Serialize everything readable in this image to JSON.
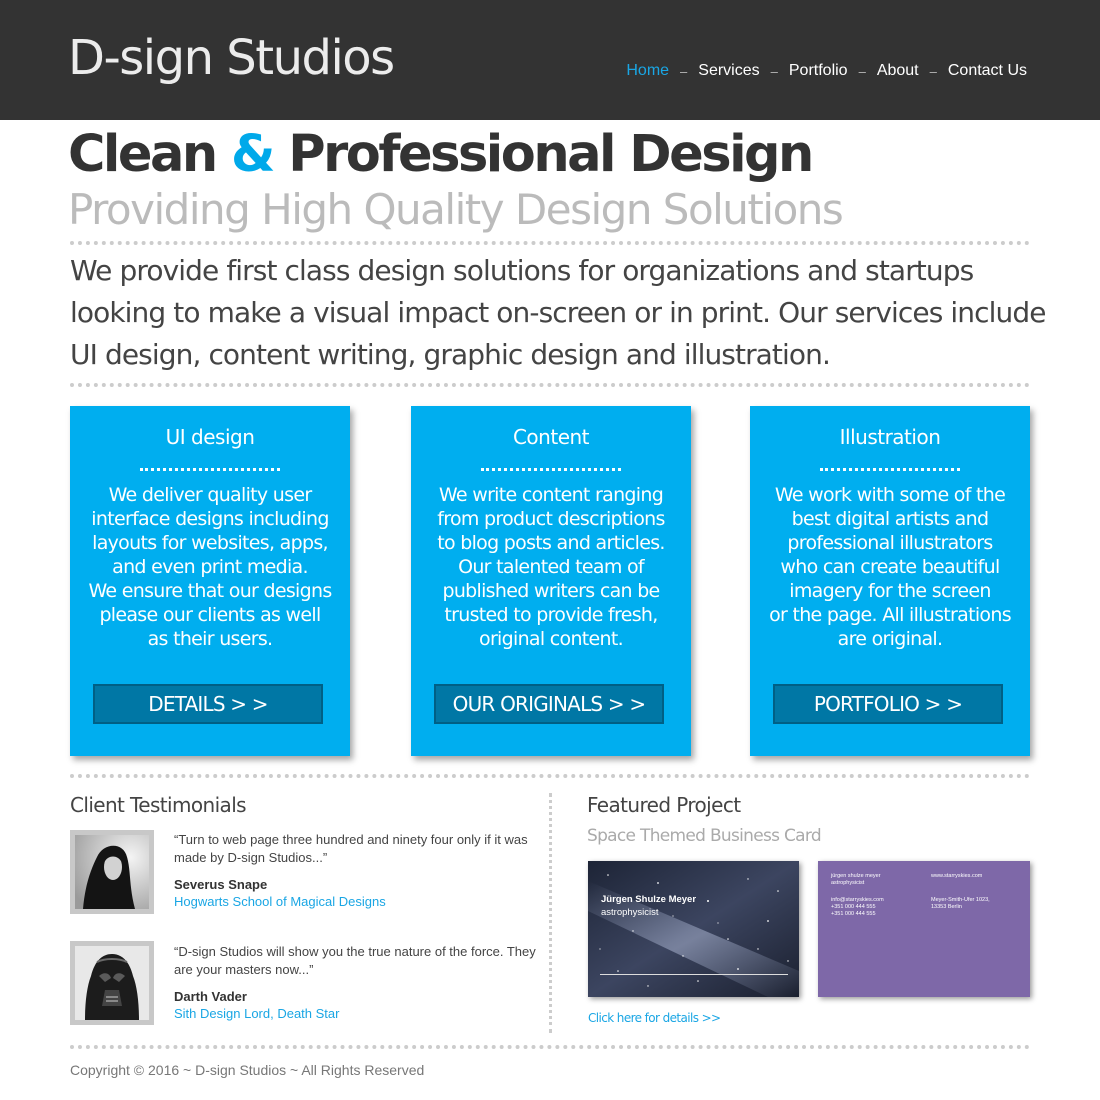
{
  "header": {
    "logo": "D-sign Studios",
    "nav": [
      "Home",
      "Services",
      "Portfolio",
      "About",
      "Contact Us"
    ],
    "nav_separator": "–",
    "active_index": 0
  },
  "hero": {
    "title_part1": "Clean",
    "title_amp": "&",
    "title_part2": "Professional Design",
    "subtitle": "Providing High Quality Design Solutions",
    "intro_line1": "We provide first class design solutions for organizations and startups",
    "intro_line2": "looking to make a visual impact on-screen or in print. Our services include",
    "intro_line3": "UI design, content writing, graphic design and illustration."
  },
  "cards": [
    {
      "title": "UI design",
      "lines": [
        "We deliver quality user",
        "interface designs including",
        "layouts for websites, apps,",
        "and even print media.",
        "We ensure that our designs",
        "please our clients as well",
        "as their users."
      ],
      "button": "DETAILS > >"
    },
    {
      "title": "Content",
      "lines": [
        "We write content ranging",
        "from product descriptions",
        "to blog posts and articles.",
        "Our talented team of",
        "published writers can be",
        "trusted to provide fresh,",
        "original content."
      ],
      "button": "OUR ORIGINALS > >"
    },
    {
      "title": "Illustration",
      "lines": [
        "We work with some of the",
        "best digital artists and",
        "professional illustrators",
        "who can create beautiful",
        "imagery for the screen",
        "or the page. All illustrations",
        "are original."
      ],
      "button": "PORTFOLIO > >"
    }
  ],
  "testimonials": {
    "title": "Client Testimonials",
    "items": [
      {
        "quote_line1": "“Turn to web page three hundred and ninety four only if it was",
        "quote_line2": "made by D-sign Studios...”",
        "name": "Severus Snape",
        "org": "Hogwarts School of Magical Designs"
      },
      {
        "quote_line1": "“D-sign Studios will show you the true nature of the force. They",
        "quote_line2": "are your masters now...”",
        "name": "Darth Vader",
        "org": "Sith Design Lord, Death Star"
      }
    ]
  },
  "featured": {
    "title": "Featured Project",
    "subtitle": "Space Themed Business Card",
    "card_front": {
      "name": "Jürgen Shulze Meyer",
      "role": "astrophysicist"
    },
    "card_back": {
      "name": "jürgen shulze meyer",
      "role": "astrophysicist",
      "email": "info@starryskies.com",
      "phone1": "+351 000 444 555",
      "phone2": "+351 000 444 555",
      "website": "www.starryskies.com",
      "address1": "Meyer-Smith-Ufer 1023,",
      "address2": "13353 Berlin"
    },
    "link": "Click here for details >>"
  },
  "footer": {
    "copyright": "Copyright © 2016 ~ D-sign Studios ~ All Rights Reserved"
  },
  "colors": {
    "header_bg": "#333333",
    "accent": "#00aeef",
    "button": "#0077a5",
    "link": "#1aa6e4",
    "card_back": "#7e68a8"
  }
}
